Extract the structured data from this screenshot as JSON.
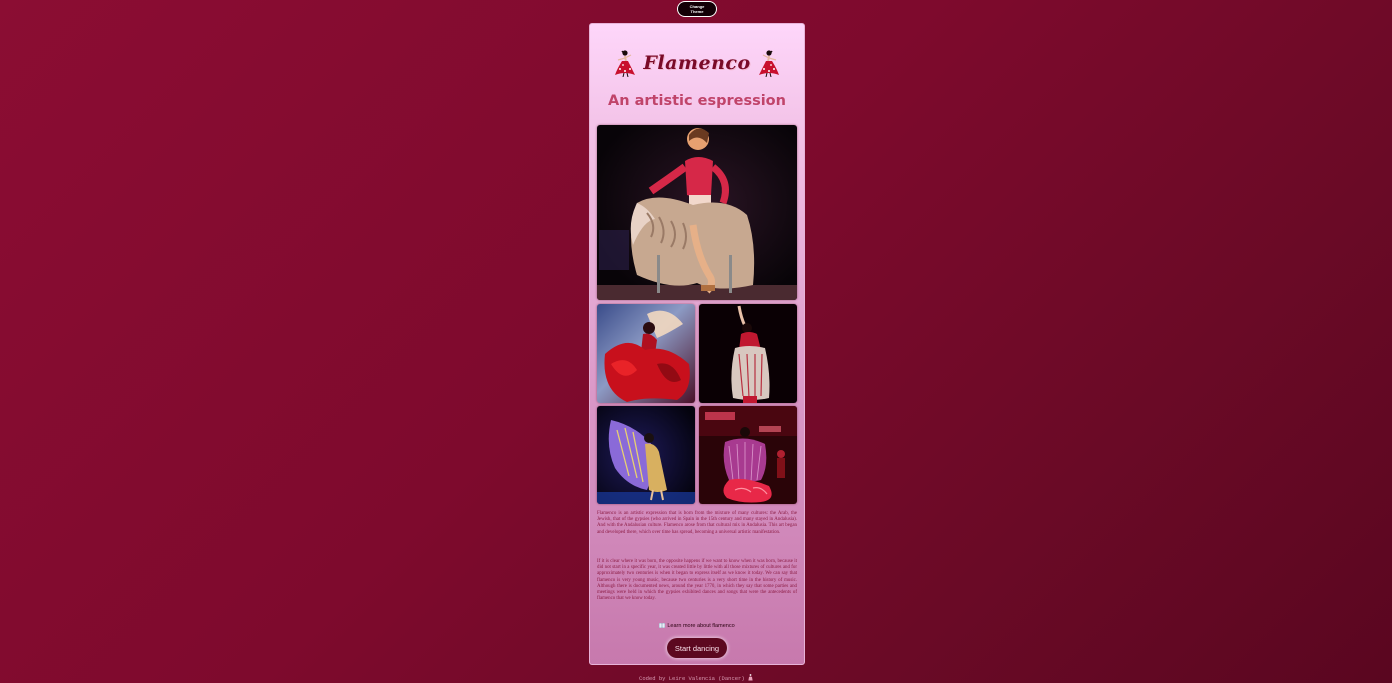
{
  "toolbar": {
    "theme_button_label": "Change Theme"
  },
  "header": {
    "logo_text": "Flamenco",
    "subtitle": "An artistic espression"
  },
  "gallery": {
    "photos": [
      {
        "icon": "dancer-seated-photo"
      },
      {
        "icon": "dancer-red-dress-photo"
      },
      {
        "icon": "dancer-fringe-shawl-photo"
      },
      {
        "icon": "dancer-purple-shawl-photo"
      },
      {
        "icon": "dancer-stage-red-photo"
      }
    ]
  },
  "content": {
    "paragraph_1": "Flamenco is an artistic expression that is born from the mixture of many cultures: the Arab, the Jewish, that of the gypsies (who arrived in Spain in the 15th century and many stayed in Andalusia). And with the Andalusian culture. Flamenco arose from that cultural mix in Andalusia. This art began and developed there, which over time has spread, becoming a universal artistic manifestation.",
    "paragraph_2": "If it is clear where it was born, the opposite happens if we want to know when it was born, because it did not start in a specific year, it was created little by little with all those mixtures of cultures and for approximately two centuries is when it began to express itself as we know it today. We can say that flamenco is very young music, because two centuries is a very short time in the history of music. Although there is documented news, around the year 1770, in which they say that some parties and meetings were held in which the gypsies exhibited dances and songs that were the antecedents of flamenco that we know today.",
    "learn_more_label": "Learn more about flamenco",
    "start_button_label": "Start dancing"
  },
  "footer": {
    "credit": "Coded by Leire Valencia (Dancer)"
  },
  "colors": {
    "background": "#7e0a2d",
    "card_top": "#fed6fa",
    "card_bottom": "#c779ad",
    "accent": "#c0446a",
    "button": "#5c0820"
  }
}
